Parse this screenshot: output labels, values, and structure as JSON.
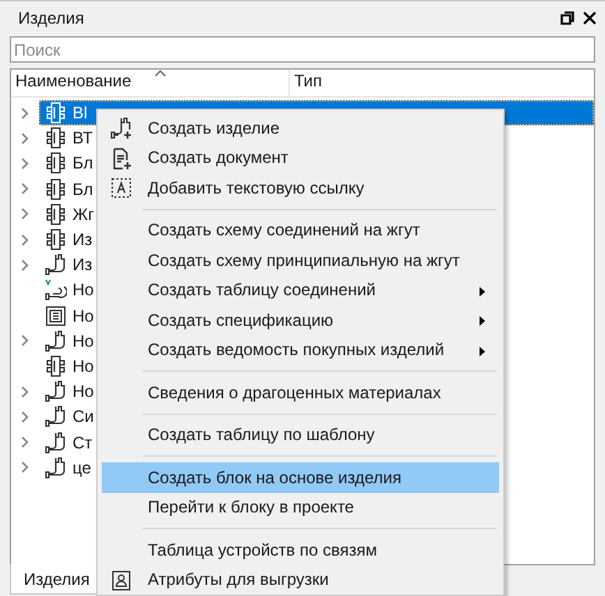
{
  "panel": {
    "title": "Изделия"
  },
  "search": {
    "placeholder": "Поиск"
  },
  "columns": [
    {
      "label": "Наименование",
      "sorted": true
    },
    {
      "label": "Тип",
      "sorted": false
    }
  ],
  "rows": [
    {
      "name": "Bl",
      "kind": "block",
      "has_children": true,
      "selected": true
    },
    {
      "name": "ВТ",
      "kind": "block",
      "has_children": true,
      "selected": false
    },
    {
      "name": "Бл",
      "kind": "block",
      "has_children": true,
      "selected": false
    },
    {
      "name": "Бл",
      "kind": "block",
      "has_children": true,
      "selected": false
    },
    {
      "name": "Жг",
      "kind": "block",
      "has_children": true,
      "selected": false
    },
    {
      "name": "Из",
      "kind": "block",
      "has_children": true,
      "selected": false
    },
    {
      "name": "Из",
      "kind": "harness",
      "has_children": true,
      "selected": false
    },
    {
      "name": "Но",
      "kind": "checked",
      "has_children": false,
      "selected": false
    },
    {
      "name": "Но",
      "kind": "panel",
      "has_children": false,
      "selected": false
    },
    {
      "name": "Но",
      "kind": "harness",
      "has_children": true,
      "selected": false
    },
    {
      "name": "Но",
      "kind": "block",
      "has_children": false,
      "selected": false
    },
    {
      "name": "Но",
      "kind": "harness",
      "has_children": true,
      "selected": false
    },
    {
      "name": "Си",
      "kind": "harness",
      "has_children": true,
      "selected": false
    },
    {
      "name": "Ст",
      "kind": "harness",
      "has_children": true,
      "selected": false
    },
    {
      "name": "це",
      "kind": "harness",
      "has_children": true,
      "selected": false
    }
  ],
  "context_menu": [
    {
      "kind": "product",
      "label": "Создать изделие",
      "submenu": false,
      "selected": false
    },
    {
      "kind": "document",
      "label": "Создать документ",
      "submenu": false,
      "selected": false
    },
    {
      "kind": "textlink",
      "label": "Добавить текстовую ссылку",
      "submenu": false,
      "selected": false
    },
    {
      "kind": "separator"
    },
    {
      "kind": "plain",
      "label": "Создать схему соединений на жгут",
      "submenu": false,
      "selected": false
    },
    {
      "kind": "plain",
      "label": "Создать схему принципиальную на жгут",
      "submenu": false,
      "selected": false
    },
    {
      "kind": "plain",
      "label": "Создать таблицу соединений",
      "submenu": true,
      "selected": false
    },
    {
      "kind": "plain",
      "label": "Создать спецификацию",
      "submenu": true,
      "selected": false
    },
    {
      "kind": "plain",
      "label": "Создать ведомость покупных изделий",
      "submenu": true,
      "selected": false
    },
    {
      "kind": "separator"
    },
    {
      "kind": "plain",
      "label": "Сведения о драгоценных материалах",
      "submenu": false,
      "selected": false
    },
    {
      "kind": "separator"
    },
    {
      "kind": "plain",
      "label": "Создать таблицу по шаблону",
      "submenu": false,
      "selected": false
    },
    {
      "kind": "separator"
    },
    {
      "kind": "plain",
      "label": "Создать блок на основе изделия",
      "submenu": false,
      "selected": true
    },
    {
      "kind": "plain",
      "label": "Перейти к блоку в проекте",
      "submenu": false,
      "selected": false
    },
    {
      "kind": "separator"
    },
    {
      "kind": "plain",
      "label": "Таблица устройств по связям",
      "submenu": false,
      "selected": false
    },
    {
      "kind": "attributes",
      "label": "Атрибуты для выгрузки",
      "submenu": false,
      "selected": false
    }
  ],
  "bottom_tabs": [
    {
      "label": "Изделия",
      "selected": true
    }
  ]
}
